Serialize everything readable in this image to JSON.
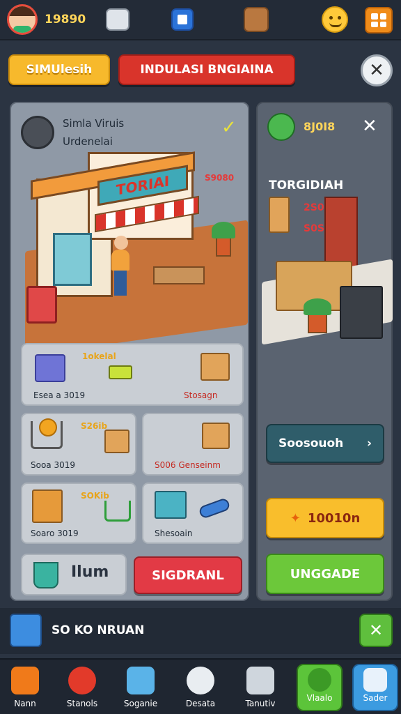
{
  "topbar": {
    "coins": "19890"
  },
  "tabs": {
    "simulation": "SIMUlesih",
    "industry": "INDULASI BNGIAINA"
  },
  "shop_panel": {
    "title_line1": "Simla Viruis",
    "title_line2": "Urdenelai",
    "shop_sign": "TORIAI",
    "sign_price": "S9080",
    "items": [
      {
        "name": "1okelal",
        "footer_left": "Esea a 3019",
        "footer_right": "Stosagn"
      },
      {
        "name": "S26ib",
        "footer_left": "Sooa 3019",
        "footer_right": "S006 Genseinm"
      },
      {
        "name": "SOKib",
        "footer_left": "Soaro 3019",
        "footer_right": "Shesoain"
      }
    ],
    "stock_label": "Ilum",
    "sell_button": "SIGDRANL"
  },
  "warehouse_panel": {
    "value": "8J0I8",
    "title": "TORGIDIAH",
    "sub_value": "2S0",
    "sub_value2": "S0S",
    "sousouh_button": "Soosouoh",
    "coin_button": "10010n",
    "upgrade_button": "UNGGADE"
  },
  "notification": {
    "text": "SO KO NRUAN"
  },
  "bottom_nav": [
    "Nann",
    "Stanols",
    "Soganie",
    "Desata",
    "Tanutiv",
    "Vlaalo",
    "Sader"
  ],
  "colors": {
    "accent_orange": "#f5b52e",
    "red": "#d9342b",
    "green": "#6cc83a",
    "blue": "#3c9be0"
  }
}
